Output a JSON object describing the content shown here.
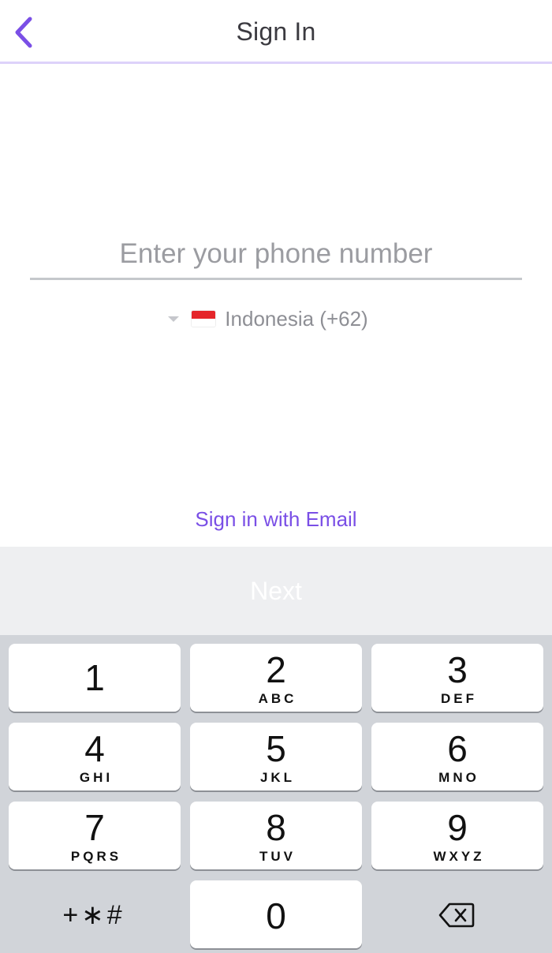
{
  "header": {
    "title": "Sign In",
    "back_icon": "chevron-left-icon",
    "accent": "#7a4fe6"
  },
  "phone": {
    "placeholder": "Enter your phone number",
    "value": ""
  },
  "country": {
    "label": "Indonesia (+62)",
    "flag_icon": "indonesia-flag-icon",
    "caret_icon": "caret-down-icon"
  },
  "email_link": {
    "label": "Sign in with Email"
  },
  "next_button": {
    "label": "Next"
  },
  "keypad": {
    "keys": [
      {
        "digit": "1",
        "letters": ""
      },
      {
        "digit": "2",
        "letters": "ABC"
      },
      {
        "digit": "3",
        "letters": "DEF"
      },
      {
        "digit": "4",
        "letters": "GHI"
      },
      {
        "digit": "5",
        "letters": "JKL"
      },
      {
        "digit": "6",
        "letters": "MNO"
      },
      {
        "digit": "7",
        "letters": "PQRS"
      },
      {
        "digit": "8",
        "letters": "TUV"
      },
      {
        "digit": "9",
        "letters": "WXYZ"
      },
      {
        "digit": "0",
        "letters": ""
      }
    ],
    "symbols_label": "+∗#",
    "delete_icon": "backspace-icon"
  }
}
